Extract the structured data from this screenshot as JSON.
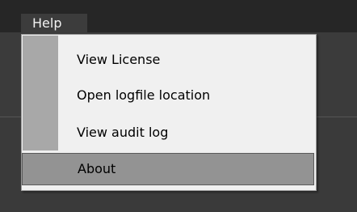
{
  "menubar": {
    "menu_title": "Help"
  },
  "help_menu": {
    "items": [
      {
        "label": "View License"
      },
      {
        "label": "Open logfile location"
      },
      {
        "label": "View audit log"
      },
      {
        "label": "About"
      }
    ],
    "highlighted_item": "About"
  },
  "colors": {
    "menubar_bg": "#262626",
    "window_bg": "#3c3c3c",
    "menu_bg": "#f0f0f0",
    "gutter": "#a8a8a8",
    "highlight": "#939393"
  }
}
